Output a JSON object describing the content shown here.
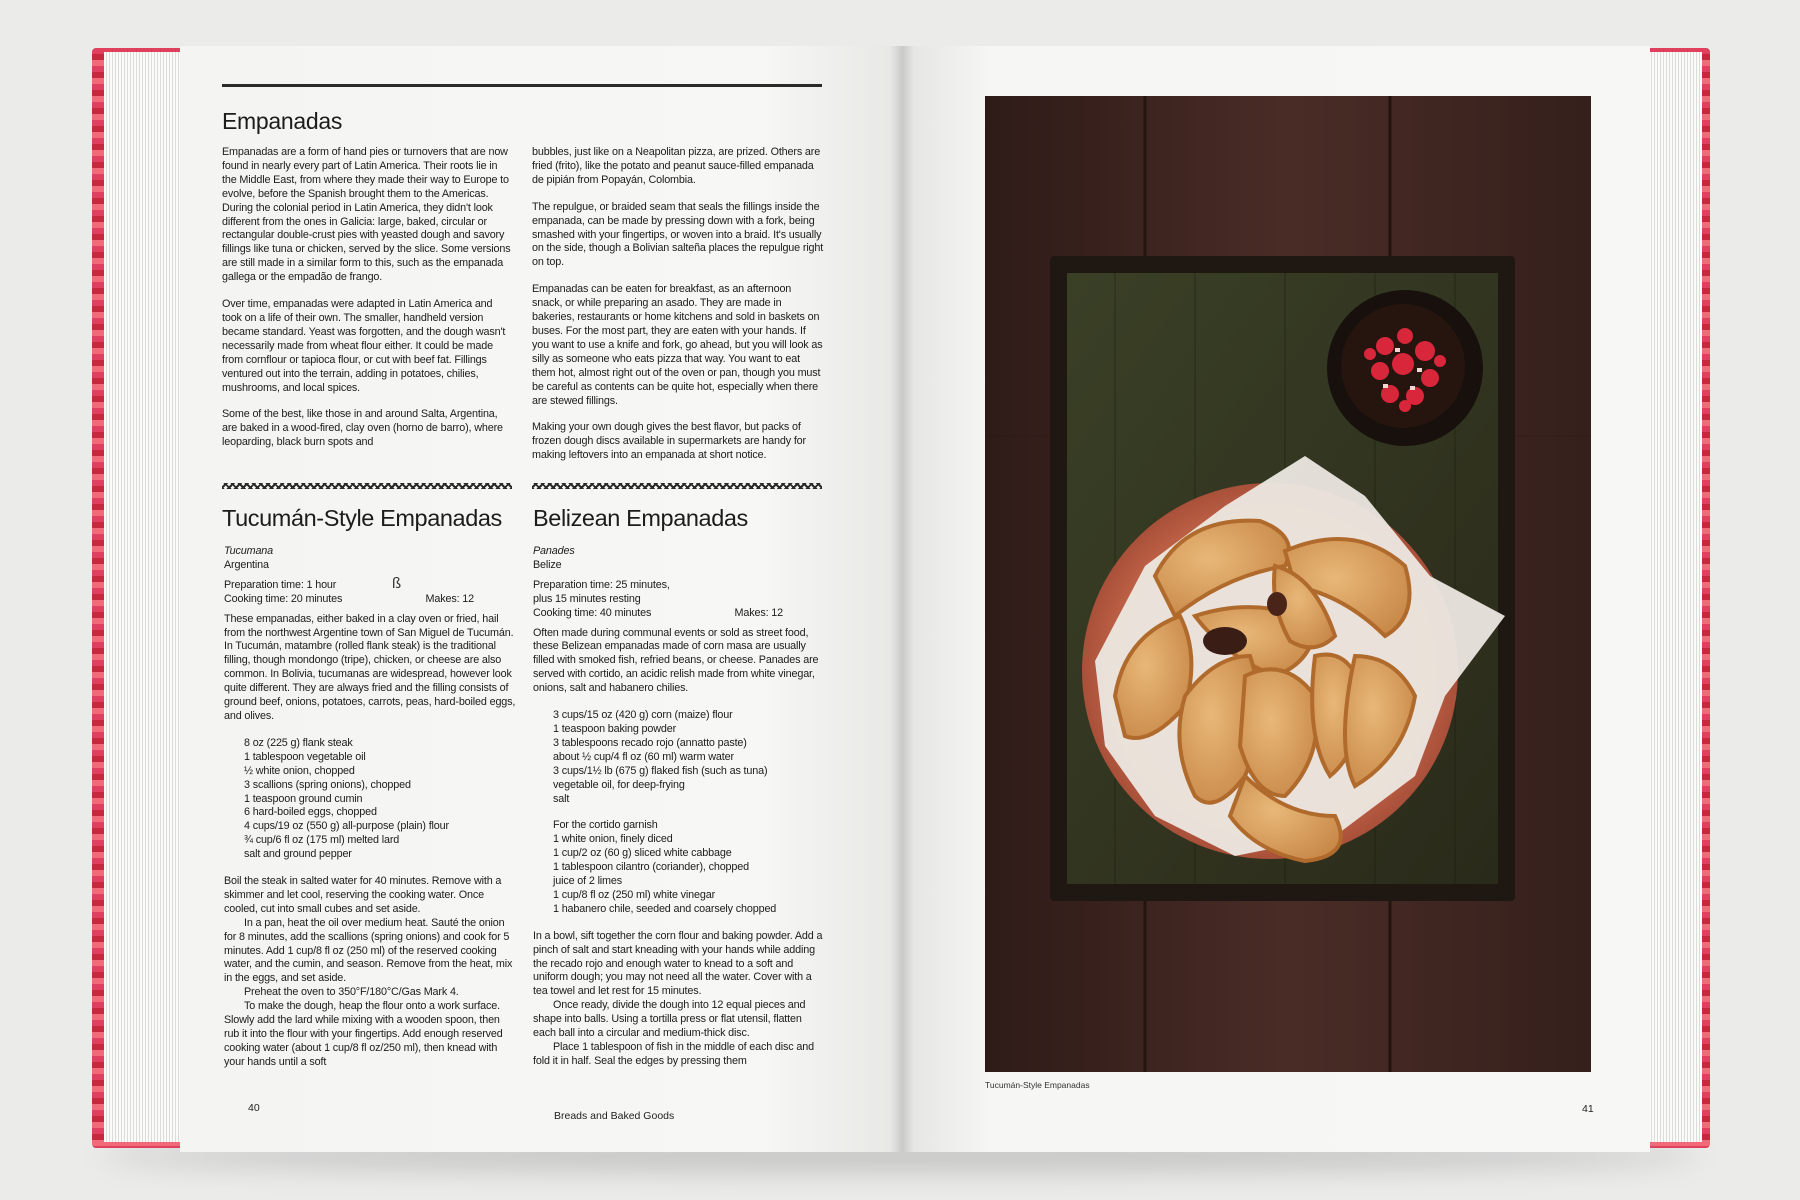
{
  "left_page": {
    "main_title": "Empanadas",
    "intro_col1": [
      "Empanadas are a form of hand pies or turnovers that are now found in nearly every part of Latin America. Their roots lie in the Middle East, from where they made their way to Europe to evolve, before the Spanish brought them to the Americas. During the colonial period in Latin America, they didn't look different from the ones in Galicia: large, baked, circular or rectangular double-crust pies with yeasted dough and savory fillings like tuna or chicken, served by the slice. Some versions are still made in a similar form to this, such as the empanada gallega or the empadão de frango.",
      "Over time, empanadas were adapted in Latin America and took on a life of their own. The smaller, handheld version became standard. Yeast was forgotten, and the dough wasn't necessarily made from wheat flour either. It could be made from cornflour or tapioca flour, or cut with beef fat. Fillings ventured out into the terrain, adding in potatoes, chilies, mushrooms, and local spices.",
      "Some of the best, like those in and around Salta, Argentina, are baked in a wood-fired, clay oven (horno de barro), where leoparding, black burn spots and"
    ],
    "intro_col2": [
      "bubbles, just like on a Neapolitan pizza, are prized. Others are fried (frito), like the potato and peanut sauce-filled empanada de pipián from Popayán, Colombia.",
      "The repulgue, or braided seam that seals the fillings inside the empanada, can be made by pressing down with a fork, being smashed with your fingertips, or woven into a braid. It's usually on the side, though a Bolivian salteña places the repulgue right on top.",
      "Empanadas can be eaten for breakfast, as an afternoon snack, or while preparing an asado. They are made in bakeries, restaurants or home kitchens and sold in baskets on buses. For the most part, they are eaten with your hands. If you want to use a knife and fork, go ahead, but you will look as silly as someone who eats pizza that way. You want to eat them hot, almost right out of the oven or pan, though you must be careful as contents can be quite hot, especially when there are stewed fillings.",
      "Making your own dough gives the best flavor, but packs of frozen dough discs available in supermarkets are handy for making leftovers into an empanada at short notice."
    ],
    "recipe1": {
      "title": "Tucumán-Style Empanadas",
      "local_name": "Tucumana",
      "country": "Argentina",
      "prep_time": "Preparation time: 1 hour",
      "cook_time": "Cooking time: 20 minutes",
      "makes": "Makes: 12",
      "mark": "ß",
      "intro": "These empanadas, either baked in a clay oven or fried, hail from the northwest Argentine town of San Miguel de Tucumán. In Tucumán, matambre (rolled flank steak) is the traditional filling, though mondongo (tripe), chicken, or cheese are also common. In Bolivia, tucumanas are widespread, however look quite different. They are always fried and the filling consists of ground beef, onions, potatoes, carrots, peas, hard-boiled eggs, and olives.",
      "ingredients": [
        "8 oz (225 g) flank steak",
        "1 tablespoon vegetable oil",
        "½ white onion, chopped",
        "3 scallions (spring onions), chopped",
        "1 teaspoon ground cumin",
        "6 hard-boiled eggs, chopped",
        "4 cups/19 oz (550 g) all-purpose (plain) flour",
        "¾ cup/6 fl oz (175 ml) melted lard",
        "salt and ground pepper"
      ],
      "method": [
        "Boil the steak in salted water for 40 minutes. Remove with a skimmer and let cool, reserving the cooking water. Once cooled, cut into small cubes and set aside.",
        "In a pan, heat the oil over medium heat. Sauté the onion for 8 minutes, add the scallions (spring onions) and cook for 5 minutes. Add 1 cup/8 fl oz (250 ml) of the reserved cooking water, and the cumin, and season. Remove from the heat, mix in the eggs, and set aside.",
        "Preheat the oven to 350°F/180°C/Gas Mark 4.",
        "To make the dough, heap the flour onto a work surface. Slowly add the lard while mixing with a wooden spoon, then rub it into the flour with your fingertips. Add enough reserved cooking water (about 1 cup/8 fl oz/250 ml), then knead with your hands until a soft"
      ]
    },
    "recipe2": {
      "title": "Belizean Empanadas",
      "local_name": "Panades",
      "country": "Belize",
      "prep_time": "Preparation time: 25 minutes,",
      "prep_time2": "plus 15 minutes resting",
      "cook_time": "Cooking time: 40 minutes",
      "makes": "Makes: 12",
      "intro": "Often made during communal events or sold as street food, these Belizean empanadas made of corn masa are usually filled with smoked fish, refried beans, or cheese. Panades are served with cortido, an acidic relish made from white vinegar, onions, salt and habanero chilies.",
      "ingredients": [
        "3 cups/15 oz (420 g) corn (maize) flour",
        "1 teaspoon baking powder",
        "3 tablespoons recado rojo (annatto paste)",
        "about ½ cup/4 fl oz (60 ml) warm water",
        "3 cups/1½ lb (675 g) flaked fish (such as tuna)",
        "vegetable oil, for deep-frying",
        "salt"
      ],
      "garnish_heading": "For the cortido garnish",
      "garnish": [
        "1 white onion, finely diced",
        "1 cup/2 oz (60 g) sliced white cabbage",
        "1 tablespoon cilantro (coriander), chopped",
        "juice of 2 limes",
        "1 cup/8 fl oz (250 ml) white vinegar",
        "1 habanero chile, seeded and coarsely chopped"
      ],
      "method": [
        "In a bowl, sift together the corn flour and baking powder. Add a pinch of salt and start kneading with your hands while adding the recado rojo and enough water to knead to a soft and uniform dough; you may not need all the water. Cover with a tea towel and let rest for 15 minutes.",
        "Once ready, divide the dough into 12 equal pieces and shape into balls. Using a tortilla press or flat utensil, flatten each ball into a circular and medium-thick disc.",
        "Place 1 tablespoon of fish in the middle of each disc and fold it in half. Seal the edges by pressing them"
      ]
    },
    "page_number": "40",
    "running_footer": "Breads and Baked Goods"
  },
  "right_page": {
    "caption": "Tucumán-Style Empanadas",
    "page_number": "41"
  },
  "colors": {
    "cover": "#d8344f",
    "paper": "#f7f7f5",
    "ink": "#1c1c1c",
    "photo_wood": "#3a2420",
    "plate": "#c7684a",
    "pastry": "#dba060"
  }
}
